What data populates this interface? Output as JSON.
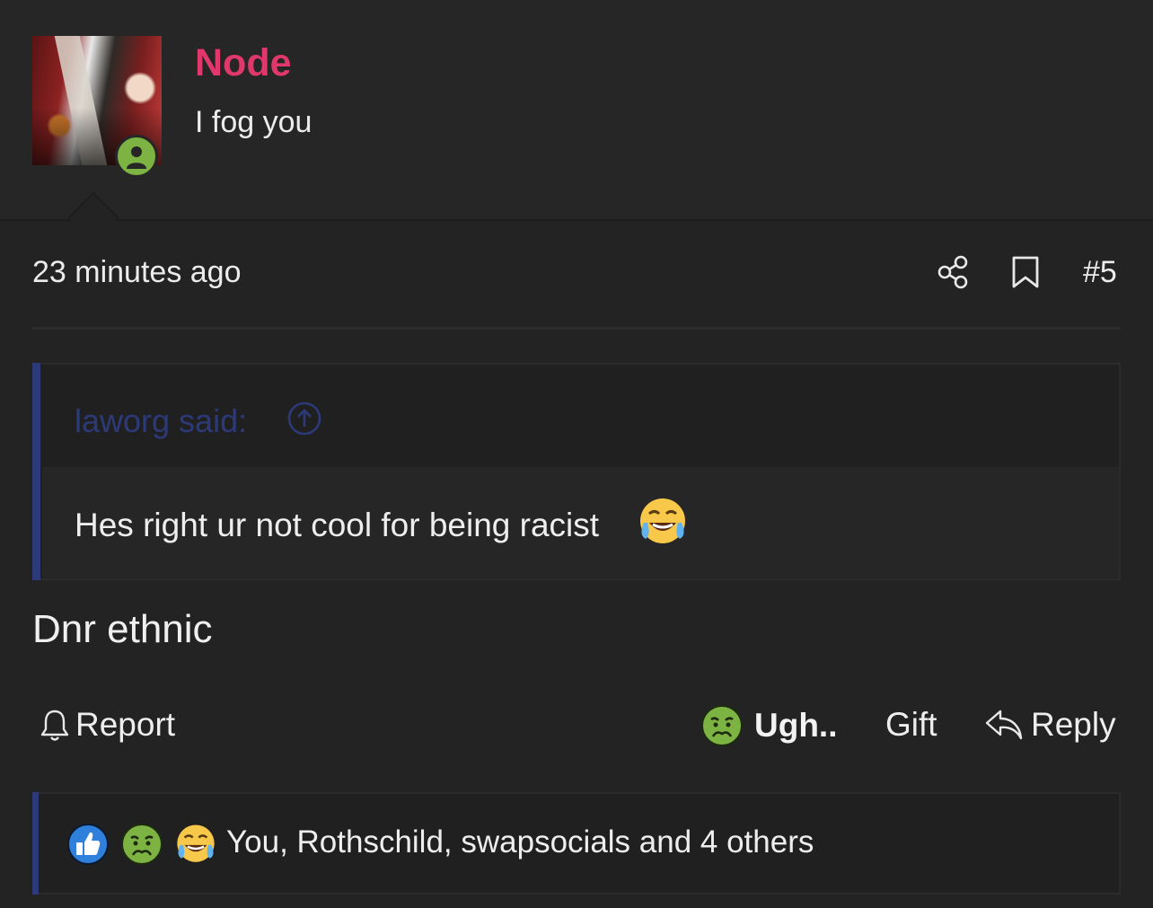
{
  "post": {
    "author": {
      "name": "Node",
      "title": "I fog you",
      "status": "online",
      "name_color": "#e0386c",
      "status_color": "#7cb342"
    },
    "timestamp": "23 minutes ago",
    "number": "#5",
    "quote": {
      "author_line": "laworg said:",
      "text": "Hes right ur not cool for being racist",
      "emoji": "laughing-tears-icon"
    },
    "message": "Dnr ethnic",
    "actions": {
      "report_label": "Report",
      "reaction_label": "Ugh..",
      "reaction_icon": "nauseated-face-icon",
      "gift_label": "Gift",
      "reply_label": "Reply"
    },
    "reactions": {
      "icons": [
        "like-icon",
        "nauseated-face-icon",
        "laughing-tears-icon"
      ],
      "summary": "You, Rothschild, swapsocials and 4 others"
    }
  },
  "colors": {
    "background": "#232323",
    "quote_accent": "#2c3a7a",
    "text": "#eeeeee"
  }
}
